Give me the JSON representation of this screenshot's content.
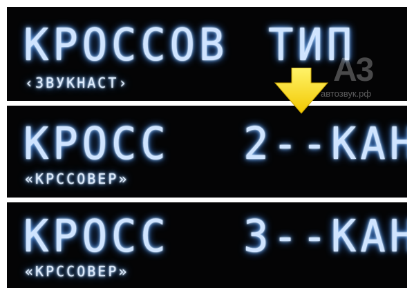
{
  "colors": {
    "background": "#040405",
    "segment_glow": "#cfe4ff",
    "separator": "#ffffff",
    "arrow": "#ffe000"
  },
  "rows": [
    {
      "main": "КРОССОВ",
      "value": "ТИП",
      "sub": "‹ЗВУКНАСТ›"
    },
    {
      "main": "КРОСС",
      "value": "2--КАН",
      "sub": "«КРССОВЕР»"
    },
    {
      "main": "КРОСС",
      "value": "3--КАН",
      "sub": "«КРССОВЕР»"
    }
  ],
  "watermark": {
    "mark": "A3",
    "site": "автозвук.рф"
  },
  "icons": {
    "arrow": "down-arrow-icon"
  }
}
